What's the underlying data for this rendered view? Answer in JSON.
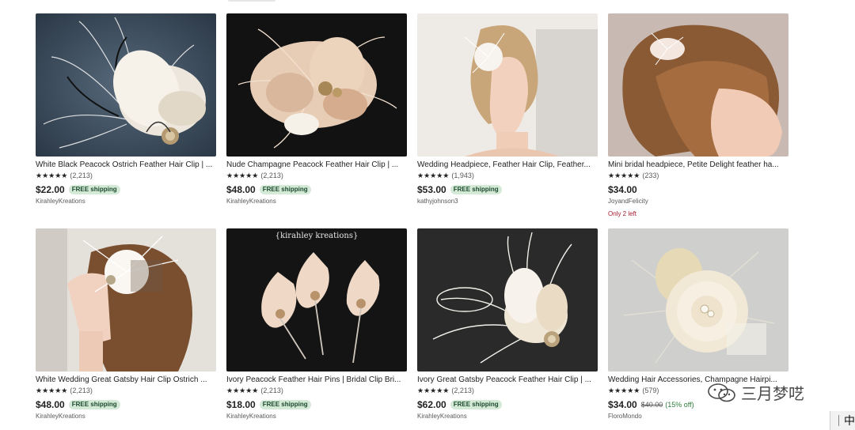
{
  "listings": [
    {
      "title": "White Black Peacock Ostrich Feather Hair Clip | ...",
      "stars": "★★★★★",
      "reviews": "(2,213)",
      "price": "$22.00",
      "badge": "FREE shipping",
      "shop": "KirahleyKreations",
      "image": "feather-clip-dark-bg"
    },
    {
      "title": "Nude Champagne Peacock Feather Hair Clip | ...",
      "stars": "★★★★★",
      "reviews": "(2,213)",
      "price": "$48.00",
      "badge": "FREE shipping",
      "shop": "KirahleyKreations",
      "image": "champagne-feather-clip"
    },
    {
      "title": "Wedding Headpiece, Feather Hair Clip, Feather...",
      "stars": "★★★★★",
      "reviews": "(1,943)",
      "price": "$53.00",
      "badge": "FREE shipping",
      "shop": "kathyjohnson3",
      "image": "bride-profile-headpiece"
    },
    {
      "title": "Mini bridal headpiece, Petite Delight feather ha...",
      "stars": "★★★★★",
      "reviews": "(233)",
      "price": "$34.00",
      "badge": "",
      "shop": "JoyandFelicity",
      "stock": "Only 2 left",
      "image": "woman-updo-mini-feather"
    },
    {
      "title": "White Wedding Great Gatsby Hair Clip Ostrich ...",
      "stars": "★★★★★",
      "reviews": "(2,213)",
      "price": "$48.00",
      "badge": "FREE shipping",
      "shop": "KirahleyKreations",
      "image": "bride-white-fascinator"
    },
    {
      "title": "Ivory Peacock Feather Hair Pins | Bridal Clip Bri...",
      "stars": "★★★★★",
      "reviews": "(2,213)",
      "price": "$18.00",
      "badge": "FREE shipping",
      "shop": "KirahleyKreations",
      "image_caption": "{kirahley kreations}",
      "image": "three-feather-pins"
    },
    {
      "title": "Ivory Great Gatsby Peacock Feather Hair Clip | ...",
      "stars": "★★★★★",
      "reviews": "(2,213)",
      "price": "$62.00",
      "badge": "FREE shipping",
      "shop": "KirahleyKreations",
      "image": "ivory-gatsby-feather-clip"
    },
    {
      "title": "Wedding Hair Accessories, Champagne Hairpi...",
      "stars": "★★★★★",
      "reviews": "(579)",
      "price": "$34.00",
      "original_price": "$40.00",
      "discount": "(15% off)",
      "badge": "",
      "shop": "FloroMondo",
      "image": "champagne-flower-clip"
    }
  ],
  "watermark": {
    "text": "三月梦呓",
    "icon": "wechat-icon"
  },
  "corner": {
    "text": "中"
  },
  "colors": {
    "badge_bg": "#d4e9d7",
    "badge_text": "#1b4a2b",
    "stock_red": "#a61a2e",
    "discount_green": "#2f7d3c"
  }
}
